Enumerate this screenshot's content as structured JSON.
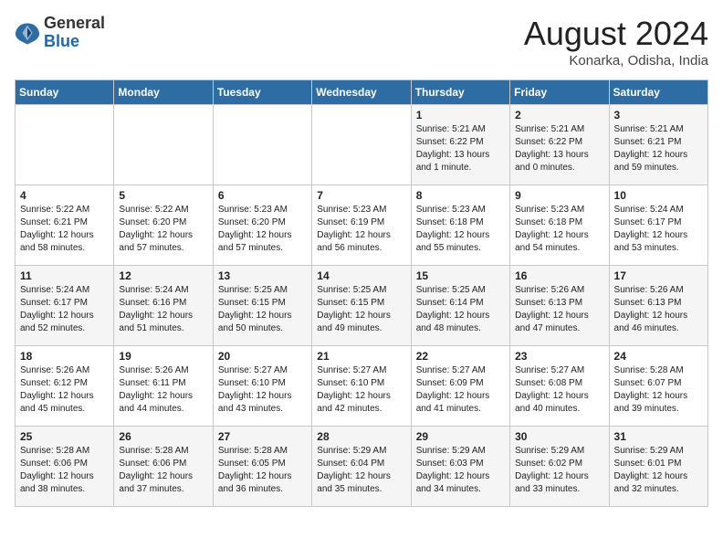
{
  "header": {
    "logo_general": "General",
    "logo_blue": "Blue",
    "month_title": "August 2024",
    "location": "Konarka, Odisha, India"
  },
  "days_of_week": [
    "Sunday",
    "Monday",
    "Tuesday",
    "Wednesday",
    "Thursday",
    "Friday",
    "Saturday"
  ],
  "weeks": [
    [
      {
        "day": "",
        "info": ""
      },
      {
        "day": "",
        "info": ""
      },
      {
        "day": "",
        "info": ""
      },
      {
        "day": "",
        "info": ""
      },
      {
        "day": "1",
        "info": "Sunrise: 5:21 AM\nSunset: 6:22 PM\nDaylight: 13 hours\nand 1 minute."
      },
      {
        "day": "2",
        "info": "Sunrise: 5:21 AM\nSunset: 6:22 PM\nDaylight: 13 hours\nand 0 minutes."
      },
      {
        "day": "3",
        "info": "Sunrise: 5:21 AM\nSunset: 6:21 PM\nDaylight: 12 hours\nand 59 minutes."
      }
    ],
    [
      {
        "day": "4",
        "info": "Sunrise: 5:22 AM\nSunset: 6:21 PM\nDaylight: 12 hours\nand 58 minutes."
      },
      {
        "day": "5",
        "info": "Sunrise: 5:22 AM\nSunset: 6:20 PM\nDaylight: 12 hours\nand 57 minutes."
      },
      {
        "day": "6",
        "info": "Sunrise: 5:23 AM\nSunset: 6:20 PM\nDaylight: 12 hours\nand 57 minutes."
      },
      {
        "day": "7",
        "info": "Sunrise: 5:23 AM\nSunset: 6:19 PM\nDaylight: 12 hours\nand 56 minutes."
      },
      {
        "day": "8",
        "info": "Sunrise: 5:23 AM\nSunset: 6:18 PM\nDaylight: 12 hours\nand 55 minutes."
      },
      {
        "day": "9",
        "info": "Sunrise: 5:23 AM\nSunset: 6:18 PM\nDaylight: 12 hours\nand 54 minutes."
      },
      {
        "day": "10",
        "info": "Sunrise: 5:24 AM\nSunset: 6:17 PM\nDaylight: 12 hours\nand 53 minutes."
      }
    ],
    [
      {
        "day": "11",
        "info": "Sunrise: 5:24 AM\nSunset: 6:17 PM\nDaylight: 12 hours\nand 52 minutes."
      },
      {
        "day": "12",
        "info": "Sunrise: 5:24 AM\nSunset: 6:16 PM\nDaylight: 12 hours\nand 51 minutes."
      },
      {
        "day": "13",
        "info": "Sunrise: 5:25 AM\nSunset: 6:15 PM\nDaylight: 12 hours\nand 50 minutes."
      },
      {
        "day": "14",
        "info": "Sunrise: 5:25 AM\nSunset: 6:15 PM\nDaylight: 12 hours\nand 49 minutes."
      },
      {
        "day": "15",
        "info": "Sunrise: 5:25 AM\nSunset: 6:14 PM\nDaylight: 12 hours\nand 48 minutes."
      },
      {
        "day": "16",
        "info": "Sunrise: 5:26 AM\nSunset: 6:13 PM\nDaylight: 12 hours\nand 47 minutes."
      },
      {
        "day": "17",
        "info": "Sunrise: 5:26 AM\nSunset: 6:13 PM\nDaylight: 12 hours\nand 46 minutes."
      }
    ],
    [
      {
        "day": "18",
        "info": "Sunrise: 5:26 AM\nSunset: 6:12 PM\nDaylight: 12 hours\nand 45 minutes."
      },
      {
        "day": "19",
        "info": "Sunrise: 5:26 AM\nSunset: 6:11 PM\nDaylight: 12 hours\nand 44 minutes."
      },
      {
        "day": "20",
        "info": "Sunrise: 5:27 AM\nSunset: 6:10 PM\nDaylight: 12 hours\nand 43 minutes."
      },
      {
        "day": "21",
        "info": "Sunrise: 5:27 AM\nSunset: 6:10 PM\nDaylight: 12 hours\nand 42 minutes."
      },
      {
        "day": "22",
        "info": "Sunrise: 5:27 AM\nSunset: 6:09 PM\nDaylight: 12 hours\nand 41 minutes."
      },
      {
        "day": "23",
        "info": "Sunrise: 5:27 AM\nSunset: 6:08 PM\nDaylight: 12 hours\nand 40 minutes."
      },
      {
        "day": "24",
        "info": "Sunrise: 5:28 AM\nSunset: 6:07 PM\nDaylight: 12 hours\nand 39 minutes."
      }
    ],
    [
      {
        "day": "25",
        "info": "Sunrise: 5:28 AM\nSunset: 6:06 PM\nDaylight: 12 hours\nand 38 minutes."
      },
      {
        "day": "26",
        "info": "Sunrise: 5:28 AM\nSunset: 6:06 PM\nDaylight: 12 hours\nand 37 minutes."
      },
      {
        "day": "27",
        "info": "Sunrise: 5:28 AM\nSunset: 6:05 PM\nDaylight: 12 hours\nand 36 minutes."
      },
      {
        "day": "28",
        "info": "Sunrise: 5:29 AM\nSunset: 6:04 PM\nDaylight: 12 hours\nand 35 minutes."
      },
      {
        "day": "29",
        "info": "Sunrise: 5:29 AM\nSunset: 6:03 PM\nDaylight: 12 hours\nand 34 minutes."
      },
      {
        "day": "30",
        "info": "Sunrise: 5:29 AM\nSunset: 6:02 PM\nDaylight: 12 hours\nand 33 minutes."
      },
      {
        "day": "31",
        "info": "Sunrise: 5:29 AM\nSunset: 6:01 PM\nDaylight: 12 hours\nand 32 minutes."
      }
    ]
  ]
}
